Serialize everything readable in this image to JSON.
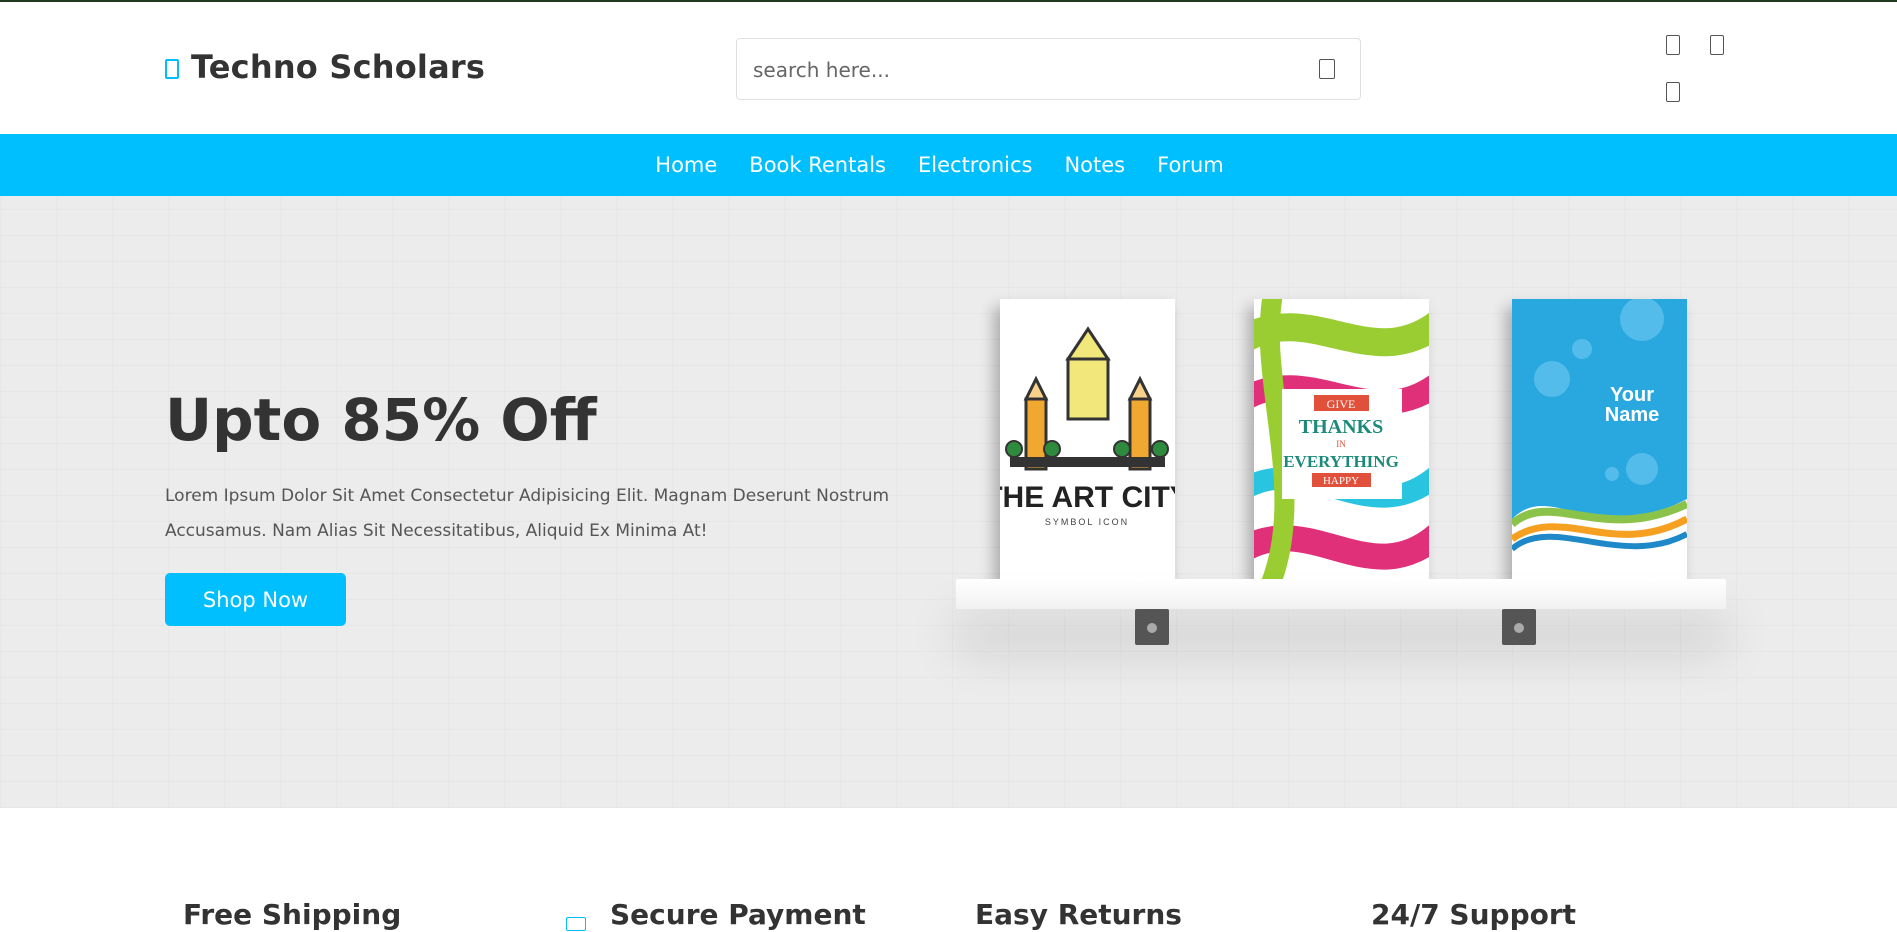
{
  "brand": {
    "name": "Techno Scholars",
    "icon": "book-icon",
    "accent_color": "#00bfff"
  },
  "search": {
    "placeholder": "search here...",
    "icon": "search-icon"
  },
  "header_icons": [
    "heart-icon",
    "cart-icon",
    "user-icon"
  ],
  "nav": {
    "items": [
      {
        "label": "Home"
      },
      {
        "label": "Book Rentals"
      },
      {
        "label": "Electronics"
      },
      {
        "label": "Notes"
      },
      {
        "label": "Forum"
      }
    ]
  },
  "hero": {
    "title": "Upto 85% Off",
    "description": "Lorem Ipsum Dolor Sit Amet Consectetur Adipisicing Elit. Magnam Deserunt Nostrum Accusamus. Nam Alias Sit Necessitatibus, Aliquid Ex Minima At!",
    "button_label": "Shop Now",
    "books": [
      {
        "title": "THE ART CITY",
        "subtitle": "SYMBOL ICON"
      },
      {
        "line1": "GIVE",
        "line2": "THANKS",
        "line3": "IN",
        "line4": "EVERYTHING",
        "line5": "HAPPY"
      },
      {
        "line1": "Your",
        "line2": "Name"
      }
    ]
  },
  "features": [
    {
      "label": "Free Shipping"
    },
    {
      "label": "Secure Payment",
      "icon": "card-icon"
    },
    {
      "label": "Easy Returns"
    },
    {
      "label": "24/7 Support"
    }
  ]
}
